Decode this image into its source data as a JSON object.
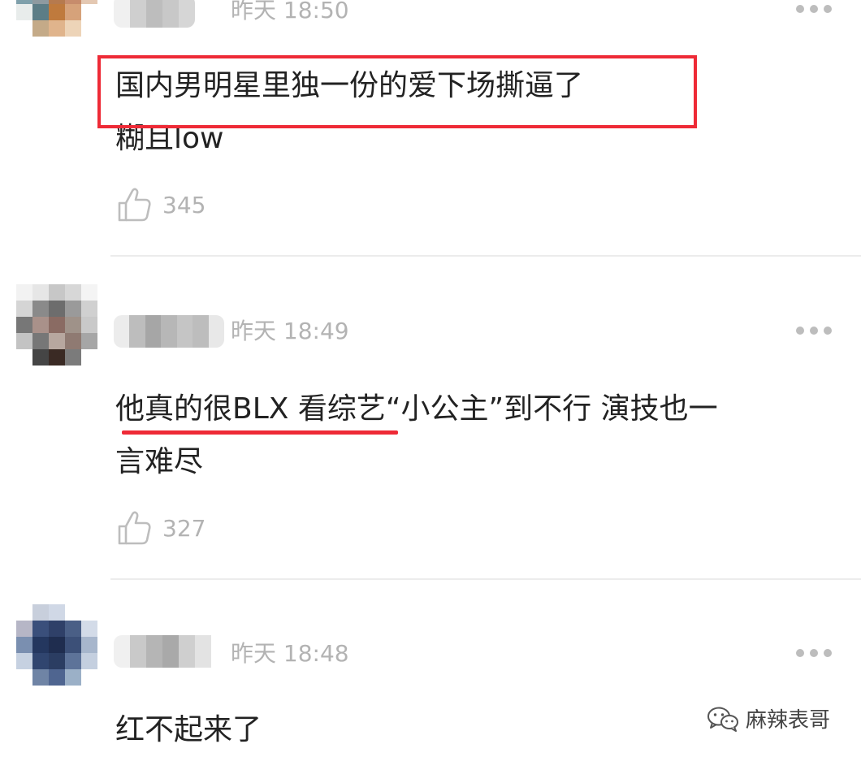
{
  "comments": [
    {
      "time": "昨天 18:50",
      "text_line1": "国内男明星里独一份的爱下场撕逼了",
      "text_line2": "糊且low",
      "likes": "345"
    },
    {
      "time": "昨天 18:49",
      "text_line1": "他真的很BLX 看综艺“小公主”到不行 演技也一",
      "text_line2": "言难尽",
      "likes": "327"
    },
    {
      "time": "昨天 18:48",
      "text_line1": "红不起来了"
    }
  ],
  "watermark": {
    "text": "麻辣表哥",
    "icon": "wechat-icon"
  },
  "colors": {
    "highlight": "#ee2a36",
    "meta_text": "#b3b3b3",
    "divider": "#ececec"
  }
}
